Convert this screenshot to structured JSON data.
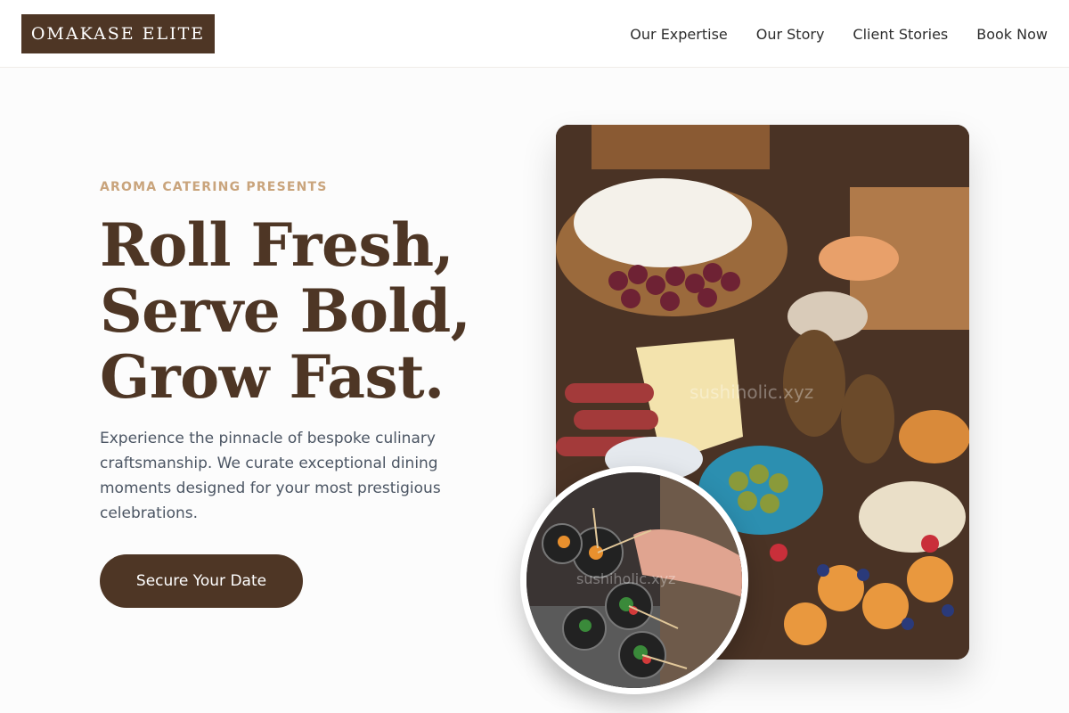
{
  "header": {
    "logo": "OMAKASE ELITE",
    "nav": [
      "Our Expertise",
      "Our Story",
      "Client Stories",
      "Book Now"
    ]
  },
  "hero": {
    "eyebrow": "AROMA CATERING PRESENTS",
    "headline": [
      "Roll Fresh,",
      "Serve Bold,",
      "Grow Fast."
    ],
    "description": "Experience the pinnacle of bespoke culinary craftsmanship. We curate exceptional dining moments designed for your most prestigious celebrations.",
    "cta_label": "Secure Your Date"
  },
  "images": {
    "main_watermark": "sushiholic.xyz",
    "inset_watermark": "sushiholic.xyz"
  },
  "colors": {
    "brand": "#4e3625",
    "accent": "#c9a47c",
    "body_text": "#4b5563",
    "background": "#fcfcfc"
  }
}
